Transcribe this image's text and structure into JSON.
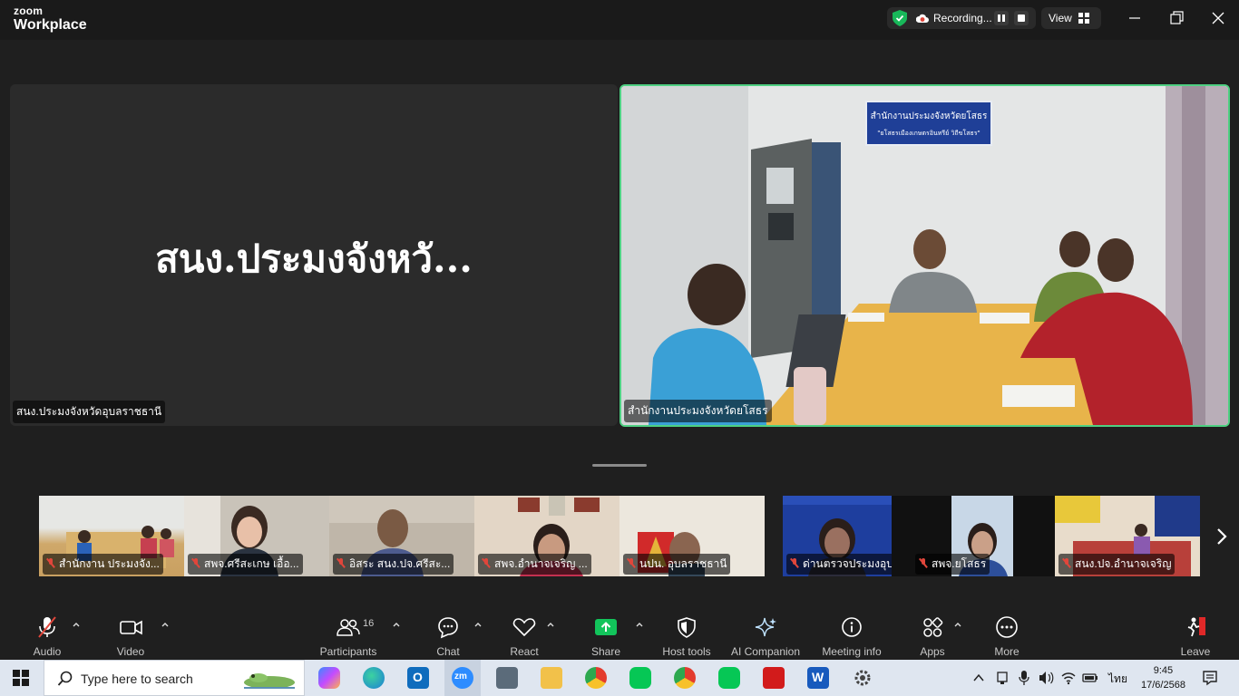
{
  "app": {
    "logo_top": "zoom",
    "logo_bottom": "Workplace",
    "recording_label": "Recording...",
    "view_label": "View"
  },
  "main": {
    "left_tile": {
      "display_name": "สนง.ประมงจังหวั...",
      "label": "สนง.ประมงจังหวัดอุบลราชธานี"
    },
    "right_tile": {
      "label": "สำนักงานประมงจังหวัดยโสธร",
      "sign_line1": "สำนักงานประมงจังหวัดยโสธร",
      "sign_line2": "\"ยโสธรเมืองเกษตรอินทรีย์ วิถีขโสธร\""
    }
  },
  "thumbnails": [
    {
      "label": "สำนักงาน ประมงจัง..."
    },
    {
      "label": "สพจ.ศรีสะเกษ เอื้อ..."
    },
    {
      "label": "อิสระ สนง.ปจ.ศรีสะ..."
    },
    {
      "label": "สพจ.อำนาจเจริญ ..."
    },
    {
      "label": "นปน. อุบลราชธานี"
    },
    {
      "label": "ด่านตรวจประมงอุบ..."
    },
    {
      "label": "สพจ.ยโสธร"
    },
    {
      "label": "สนง.ปจ.อำนาจเจริญ"
    }
  ],
  "toolbar": {
    "audio": "Audio",
    "video": "Video",
    "participants": "Participants",
    "participants_count": "16",
    "chat": "Chat",
    "react": "React",
    "share": "Share",
    "host_tools": "Host tools",
    "ai_companion": "AI Companion",
    "meeting_info": "Meeting info",
    "apps": "Apps",
    "more": "More",
    "leave": "Leave"
  },
  "taskbar": {
    "search_placeholder": "Type here to search",
    "language": "ไทย",
    "time": "9:45",
    "date": "17/6/2568"
  },
  "colors": {
    "active_speaker_border": "#4ed082",
    "muted_mic": "#e0463b",
    "share_green": "#12c45b",
    "leave_red": "#e02828"
  }
}
